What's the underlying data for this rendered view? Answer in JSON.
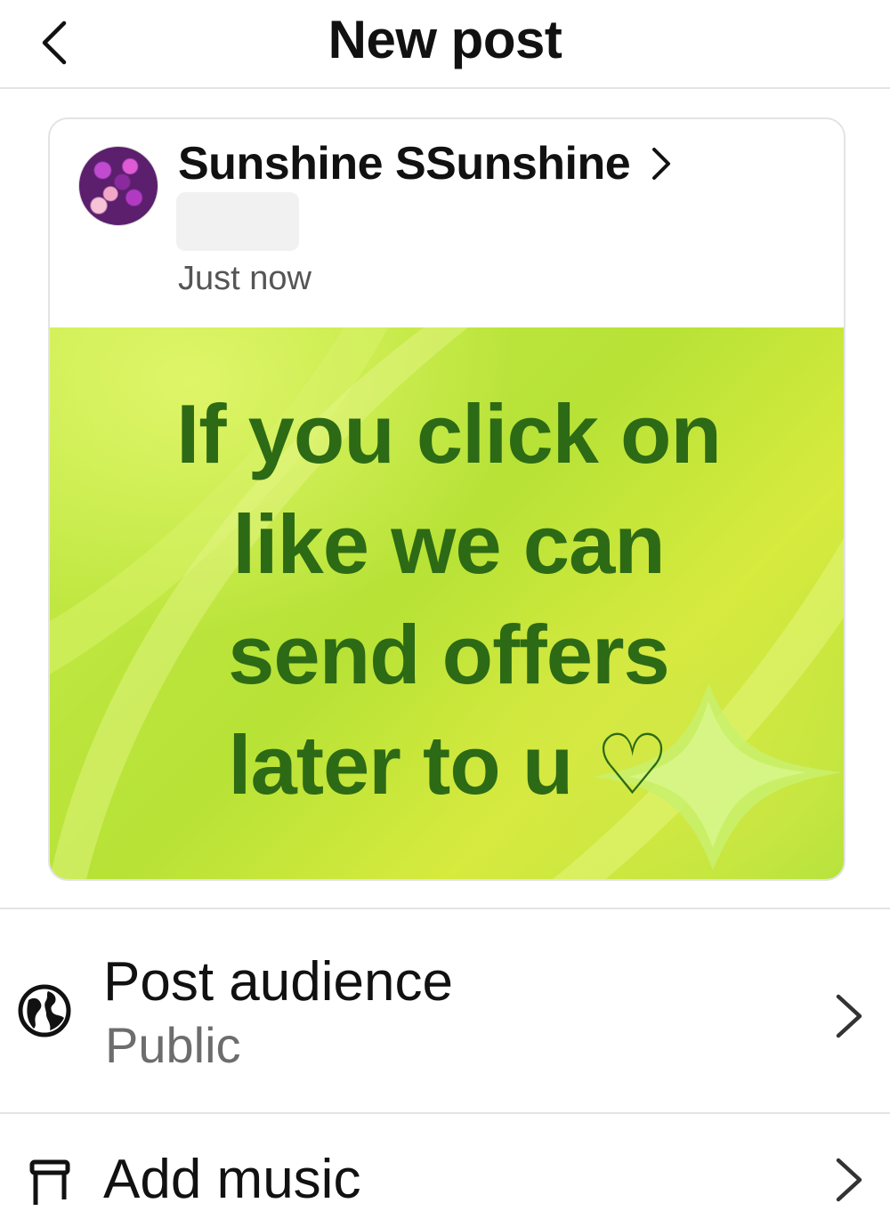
{
  "header": {
    "title": "New post",
    "back_icon": "chevron-left-icon"
  },
  "post": {
    "author": "Sunshine SSunshine",
    "timestamp": "Just now",
    "image_text_lines": [
      "If you click on",
      "like we can",
      "send offers",
      "later to u ♡"
    ],
    "image_colors": {
      "background": "#bfe63f",
      "text": "#2d6a15"
    }
  },
  "settings": {
    "audience": {
      "title": "Post audience",
      "value": "Public",
      "icon": "globe-icon"
    },
    "music": {
      "title": "Add music",
      "icon": "music-icon"
    }
  }
}
